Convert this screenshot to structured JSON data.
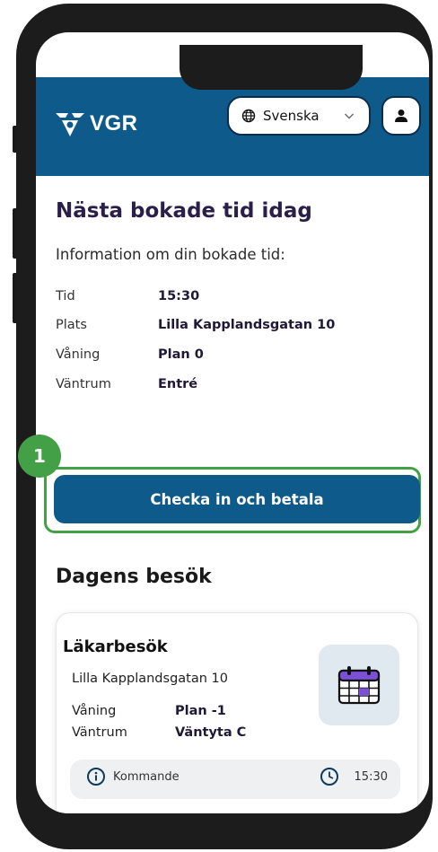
{
  "header": {
    "logo_text": "VGR",
    "language": "Svenska"
  },
  "appointment": {
    "heading": "Nästa bokade tid idag",
    "intro": "Information om din bokade tid:",
    "rows": [
      {
        "label": "Tid",
        "value": "15:30"
      },
      {
        "label": "Plats",
        "value": "Lilla Kapplandsgatan 10"
      },
      {
        "label": "Våning",
        "value": "Plan 0"
      },
      {
        "label": "Väntrum",
        "value": "Entré"
      }
    ]
  },
  "cta": {
    "label": "Checka in och betala",
    "step_number": "1"
  },
  "visits": {
    "heading": "Dagens besök",
    "card": {
      "title": "Läkarbesök",
      "address": "Lilla Kapplandsgatan 10",
      "rows": [
        {
          "label": "Våning",
          "value": "Plan -1"
        },
        {
          "label": "Väntrum",
          "value": "Väntyta C"
        }
      ],
      "status": "Kommande",
      "time": "15:30"
    }
  },
  "colors": {
    "brand_blue": "#0e5a8a",
    "highlight_green": "#43a047",
    "calendar_purple": "#7b4fd6"
  }
}
